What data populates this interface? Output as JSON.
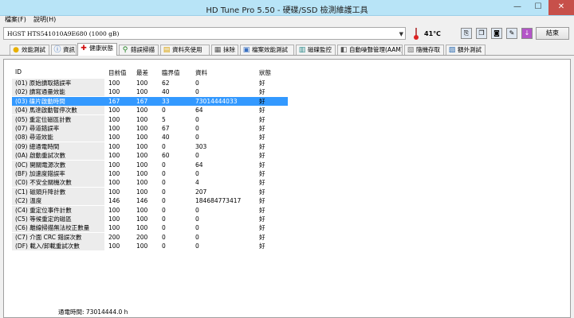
{
  "window": {
    "title": "HD Tune Pro 5.50 - 硬碟/SSD 檢測維護工具",
    "min": "—",
    "max": "☐",
    "close": "✕"
  },
  "menu": {
    "file": "檔案(F)",
    "help": "說明(H)"
  },
  "toolbar": {
    "drive": "HGST HTS541010A9E680 (1000 gB)",
    "temperature": "41℃",
    "exit_label": "結束"
  },
  "tabs": [
    {
      "label": "效能測試",
      "icon": "benchmark-icon"
    },
    {
      "label": "資訊",
      "icon": "info-icon"
    },
    {
      "label": "健康狀態",
      "icon": "health-icon"
    },
    {
      "label": "錯誤掃描",
      "icon": "error-scan-icon"
    },
    {
      "label": "資料夾使用",
      "icon": "folder-usage-icon"
    },
    {
      "label": "抹除",
      "icon": "erase-icon"
    },
    {
      "label": "檔案效能測試",
      "icon": "file-benchmark-icon"
    },
    {
      "label": "磁碟監控",
      "icon": "disk-monitor-icon"
    },
    {
      "label": "自動噪聲管理(AAM)",
      "icon": "aam-icon"
    },
    {
      "label": "隨機存取",
      "icon": "random-access-icon"
    },
    {
      "label": "額外測試",
      "icon": "extra-tests-icon"
    }
  ],
  "columns": {
    "id": "ID",
    "current": "目前值",
    "worst": "最差",
    "threshold": "臨界值",
    "data": "資料",
    "status": "狀態"
  },
  "rows": [
    {
      "id": "(01) 原始讀取錯誤率",
      "current": "100",
      "worst": "100",
      "threshold": "62",
      "data": "0",
      "status": "好"
    },
    {
      "id": "(02) 讀寫通量效能",
      "current": "100",
      "worst": "100",
      "threshold": "40",
      "data": "0",
      "status": "好"
    },
    {
      "id": "(03) 碟片啟動時間",
      "current": "167",
      "worst": "167",
      "threshold": "33",
      "data": "73014444033",
      "status": "好"
    },
    {
      "id": "(04) 馬達啟動暫停次數",
      "current": "100",
      "worst": "100",
      "threshold": "0",
      "data": "64",
      "status": "好"
    },
    {
      "id": "(05) 重定位磁區計數",
      "current": "100",
      "worst": "100",
      "threshold": "5",
      "data": "0",
      "status": "好"
    },
    {
      "id": "(07) 尋道錯誤率",
      "current": "100",
      "worst": "100",
      "threshold": "67",
      "data": "0",
      "status": "好"
    },
    {
      "id": "(08) 尋道效能",
      "current": "100",
      "worst": "100",
      "threshold": "40",
      "data": "0",
      "status": "好"
    },
    {
      "id": "(09) 總通電時間",
      "current": "100",
      "worst": "100",
      "threshold": "0",
      "data": "303",
      "status": "好"
    },
    {
      "id": "(0A) 啟動重試次數",
      "current": "100",
      "worst": "100",
      "threshold": "60",
      "data": "0",
      "status": "好"
    },
    {
      "id": "(0C) 開關電源次數",
      "current": "100",
      "worst": "100",
      "threshold": "0",
      "data": "64",
      "status": "好"
    },
    {
      "id": "(BF) 加速度錯誤率",
      "current": "100",
      "worst": "100",
      "threshold": "0",
      "data": "0",
      "status": "好"
    },
    {
      "id": "(C0) 不安全關機次數",
      "current": "100",
      "worst": "100",
      "threshold": "0",
      "data": "4",
      "status": "好"
    },
    {
      "id": "(C1) 磁頭升降計數",
      "current": "100",
      "worst": "100",
      "threshold": "0",
      "data": "207",
      "status": "好"
    },
    {
      "id": "(C2) 溫度",
      "current": "146",
      "worst": "146",
      "threshold": "0",
      "data": "184684773417",
      "status": "好"
    },
    {
      "id": "(C4) 重定位事件計數",
      "current": "100",
      "worst": "100",
      "threshold": "0",
      "data": "0",
      "status": "好"
    },
    {
      "id": "(C5) 等候重定的磁區",
      "current": "100",
      "worst": "100",
      "threshold": "0",
      "data": "0",
      "status": "好"
    },
    {
      "id": "(C6) 離線掃描無法校正數量",
      "current": "100",
      "worst": "100",
      "threshold": "0",
      "data": "0",
      "status": "好"
    },
    {
      "id": "(C7) 介面 CRC 錯誤次數",
      "current": "200",
      "worst": "200",
      "threshold": "0",
      "data": "0",
      "status": "好"
    },
    {
      "id": "(DF) 載入/卸載重試次數",
      "current": "100",
      "worst": "100",
      "threshold": "0",
      "data": "0",
      "status": "好"
    }
  ],
  "selected_row": 2,
  "bottom_partial": "通電時間: 73014444.0 h"
}
